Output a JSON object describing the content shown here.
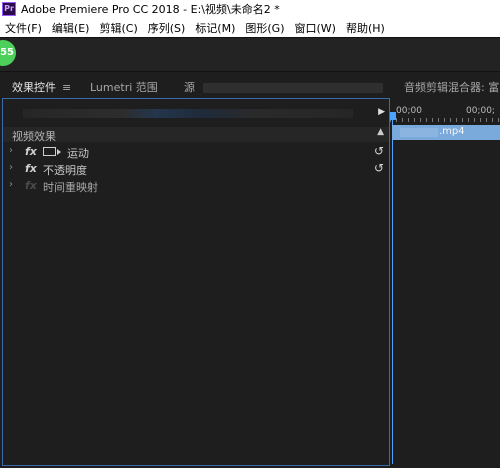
{
  "window": {
    "title": "Adobe Premiere Pro CC 2018 - E:\\视频\\未命名2 *",
    "app_icon_text": "Pr"
  },
  "menu": [
    "文件(F)",
    "编辑(E)",
    "剪辑(C)",
    "序列(S)",
    "标记(M)",
    "图形(G)",
    "窗口(W)",
    "帮助(H)"
  ],
  "toolbar": {
    "badge": "55"
  },
  "tabs": {
    "effect_controls": "效果控件",
    "lumetri": "Lumetri 范围",
    "source": "源",
    "audio_mixer": "音频剪辑混合器: 富"
  },
  "effects_panel": {
    "section_label": "视频效果",
    "fx_label": "fx",
    "effects": [
      {
        "name": "运动",
        "has_reset": true
      },
      {
        "name": "不透明度",
        "has_reset": true
      },
      {
        "name": "时间重映射",
        "has_reset": false
      }
    ]
  },
  "timeline": {
    "time_start": "00;00",
    "time_next": "00;00;",
    "clip_name": ".mp4",
    "clip_color": "#7aa9dc",
    "playhead_color": "#4aa3ff"
  }
}
